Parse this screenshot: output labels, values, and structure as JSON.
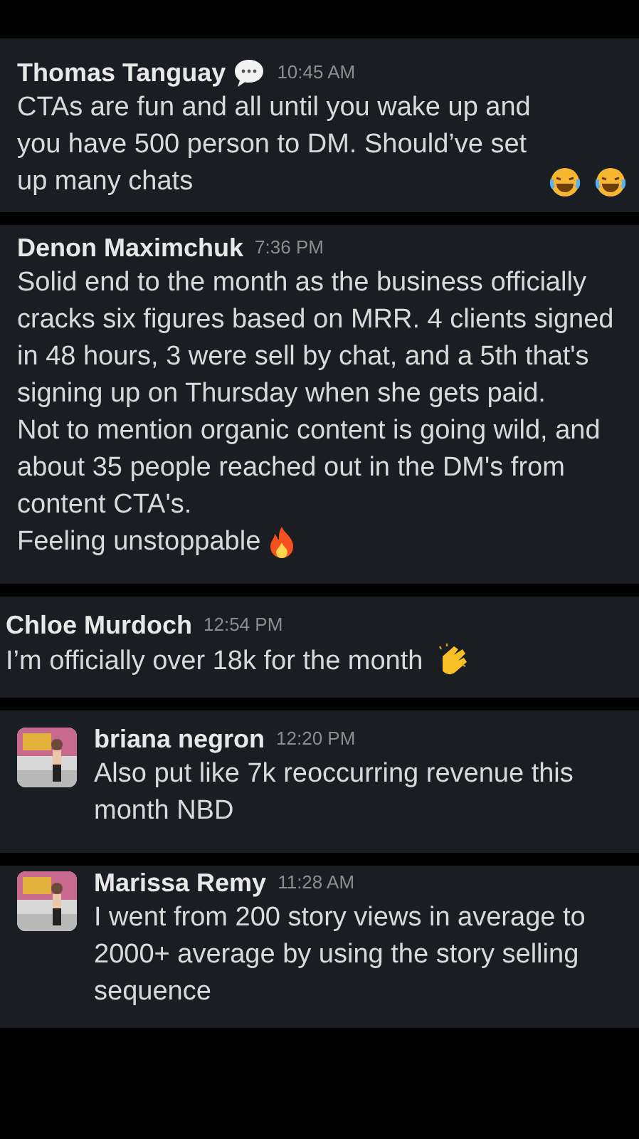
{
  "messages": [
    {
      "author": "Thomas Tanguay",
      "status": {
        "kind": "speech"
      },
      "time": "10:45 AM",
      "paragraphs": [
        "CTAs are fun and all until you wake up and you have 500 person to DM. Should’ve set up many chats"
      ],
      "emoji": [
        {
          "kind": "laughing"
        },
        {
          "kind": "laughing"
        }
      ]
    },
    {
      "author": "Denon Maximchuk",
      "time": "7:36 PM",
      "paragraphs": [
        "Solid end to the month as the business officially cracks six figures based on MRR.  4 clients signed in 48 hours, 3 were sell by chat, and a 5th that's signing up on Thursday when she gets paid.",
        "Not to mention organic content is going wild, and about 35 people reached out in the DM's from content CTA's.",
        "Feeling unstoppable"
      ],
      "emoji": [
        {
          "kind": "fire"
        }
      ]
    },
    {
      "author": "Chloe Murdoch",
      "time": "12:54 PM",
      "paragraphs": [
        "I’m officially over 18k for the month"
      ],
      "emoji": [
        {
          "kind": "clapping"
        }
      ]
    },
    {
      "author": "briana negron",
      "time": "12:20 PM",
      "avatar": {
        "kind": "picture"
      },
      "paragraphs": [
        "Also put like 7k reoccurring revenue this month NBD"
      ]
    },
    {
      "author": "Marissa Remy",
      "time": "11:28 AM",
      "avatar": {
        "kind": "picture"
      },
      "paragraphs": [
        "I went from 200 story views in average to 2000+ average by using the story selling sequence"
      ]
    }
  ]
}
